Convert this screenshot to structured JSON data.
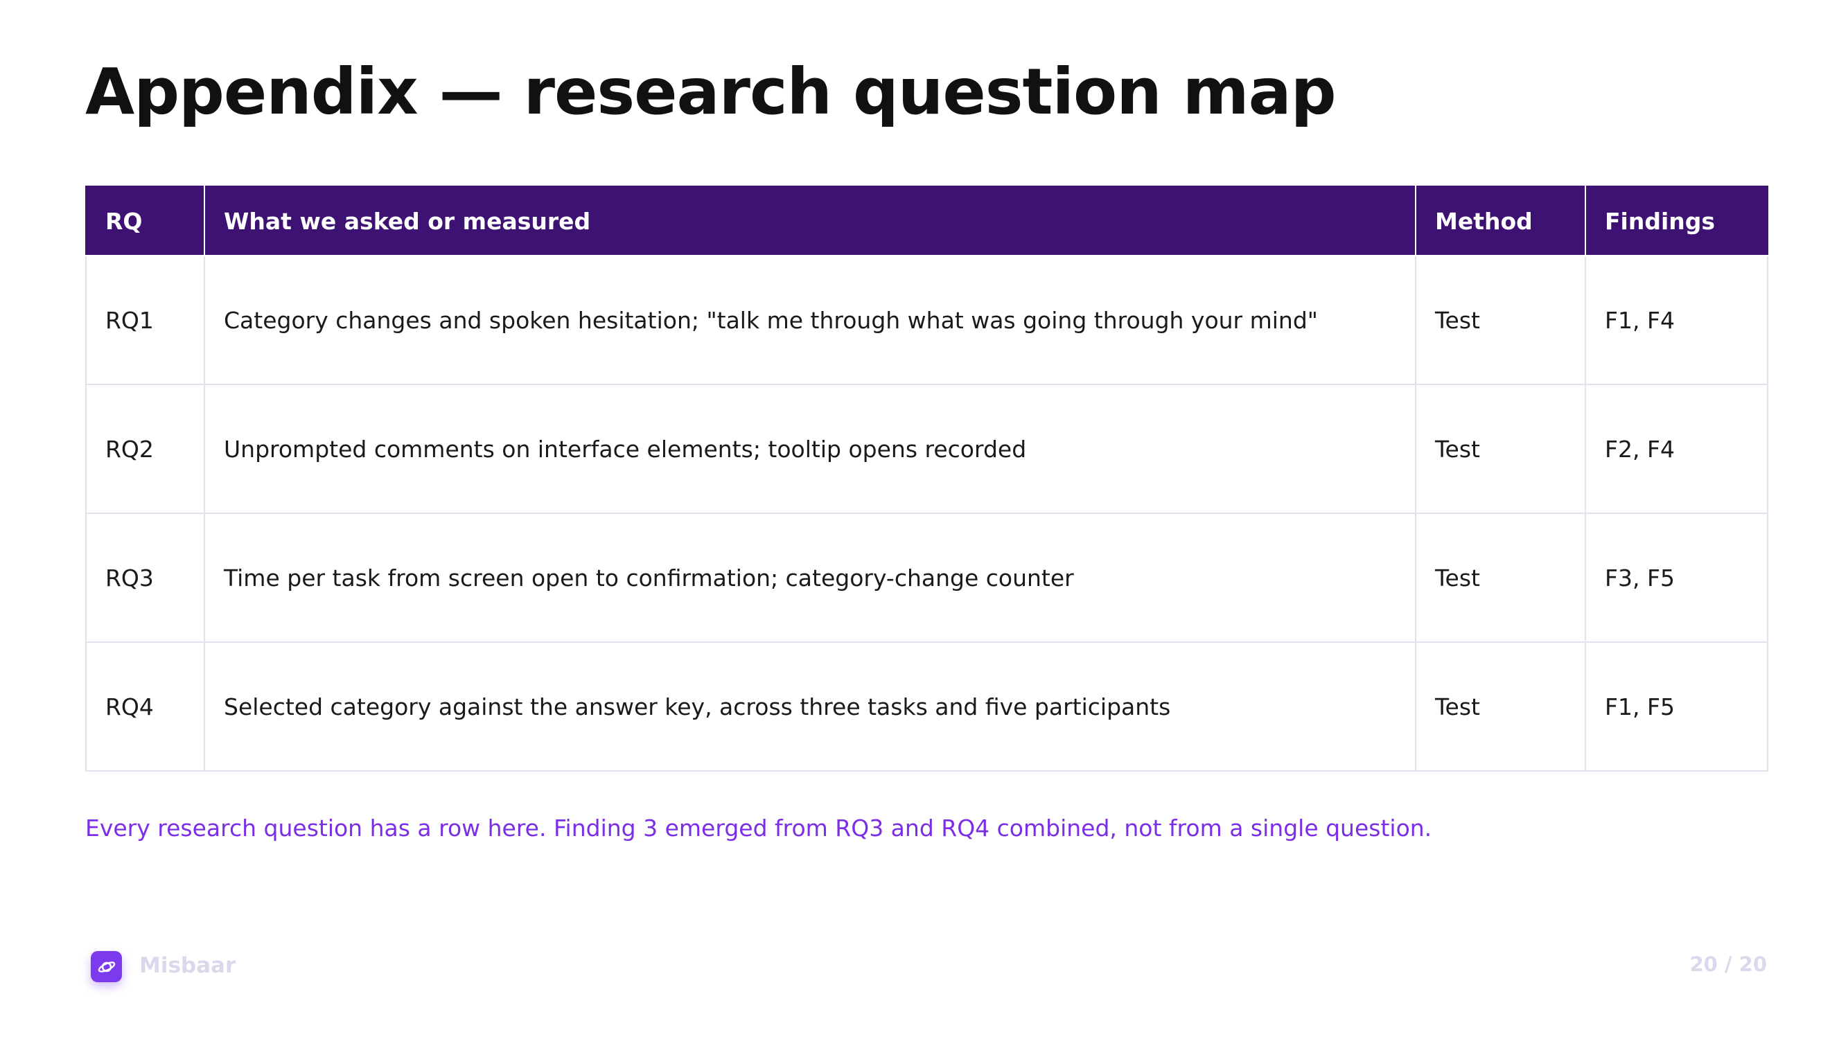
{
  "slide": {
    "title": "Appendix — research question map",
    "note": "Every research question has a row here. Finding 3 emerged from RQ3 and RQ4 combined, not from a single question."
  },
  "table": {
    "headers": {
      "rq": "RQ",
      "what": "What we asked or measured",
      "method": "Method",
      "findings": "Findings"
    },
    "rows": [
      {
        "rq": "RQ1",
        "what": "Category changes and spoken hesitation; \"talk me through what was going through your mind\"",
        "method": "Test",
        "findings": "F1, F4"
      },
      {
        "rq": "RQ2",
        "what": "Unprompted comments on interface elements; tooltip opens recorded",
        "method": "Test",
        "findings": "F2, F4"
      },
      {
        "rq": "RQ3",
        "what": "Time per task from screen open to confirmation; category-change counter",
        "method": "Test",
        "findings": "F3, F5"
      },
      {
        "rq": "RQ4",
        "what": "Selected category against the answer key, across three tasks and five participants",
        "method": "Test",
        "findings": "F1, F5"
      }
    ]
  },
  "footer": {
    "brand": "Misbaar",
    "logo_icon": "planet-icon",
    "page": "20 / 20"
  },
  "colors": {
    "header_bg": "#3d1273",
    "accent": "#7b2ee6",
    "logo_bg": "#7c3aed",
    "border": "#e3e1ee",
    "footer_text": "#dcd8ec"
  }
}
